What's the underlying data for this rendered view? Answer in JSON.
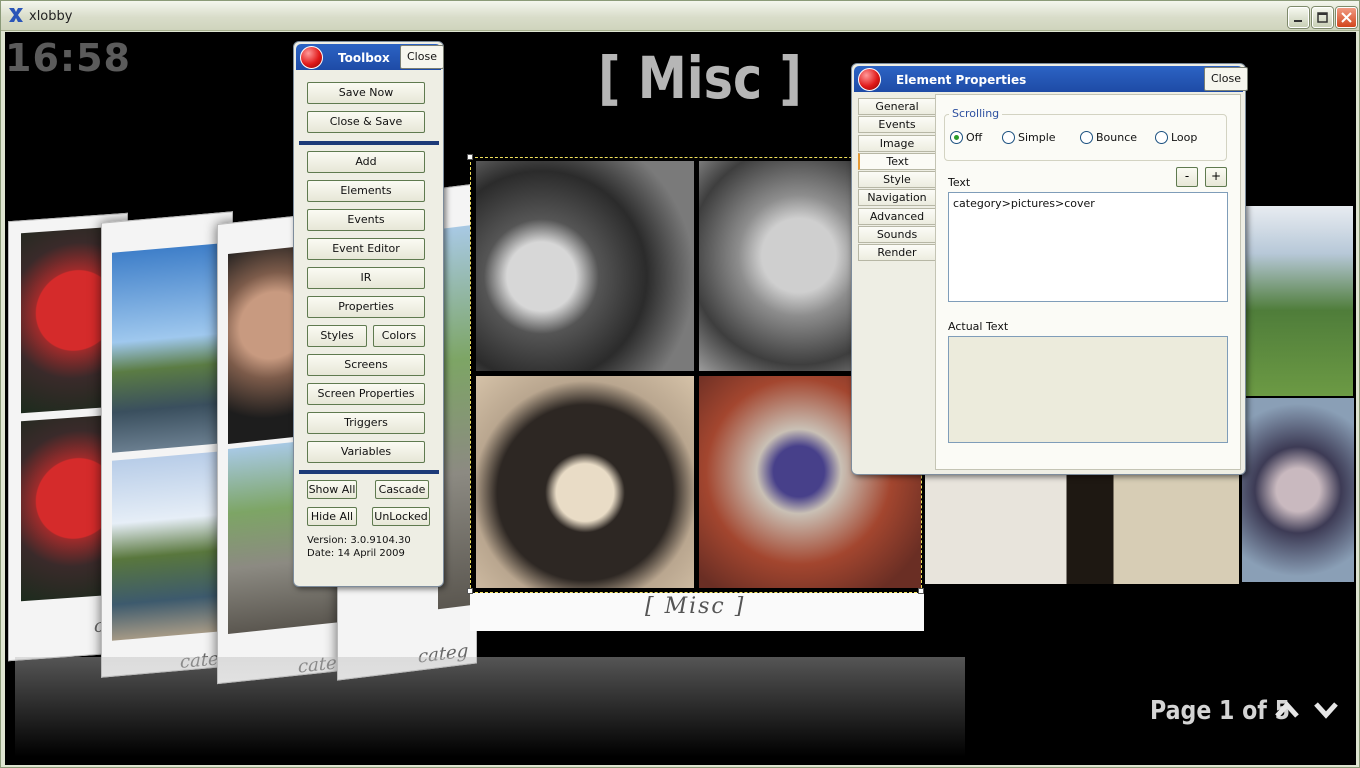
{
  "window": {
    "title": "xlobby"
  },
  "clock": "16:58",
  "screen_title": "[ Misc ]",
  "main_caption": "[ Misc ]",
  "card_captions": [
    "c",
    "categ",
    "categ",
    "categ"
  ],
  "pagination": {
    "label": "Page 1 of  5"
  },
  "toolbox": {
    "title": "Toolbox",
    "close_label": "Close",
    "save_now": "Save Now",
    "close_save": "Close & Save",
    "add": "Add",
    "elements": "Elements",
    "events": "Events",
    "event_editor": "Event Editor",
    "ir": "IR",
    "properties": "Properties",
    "styles": "Styles",
    "colors": "Colors",
    "screens": "Screens",
    "screen_properties": "Screen Properties",
    "triggers": "Triggers",
    "variables": "Variables",
    "show_all": "Show All",
    "cascade": "Cascade",
    "hide_all": "Hide All",
    "unlocked": "UnLocked",
    "version": "Version: 3.0.9104.30",
    "date": "Date: 14 April 2009"
  },
  "element_properties": {
    "title": "Element Properties",
    "close_label": "Close",
    "tabs": [
      "General",
      "Events",
      "Image",
      "Text",
      "Style",
      "Navigation",
      "Advanced",
      "Sounds",
      "Render"
    ],
    "active_tab": "Text",
    "scrolling": {
      "legend": "Scrolling",
      "options": [
        "Off",
        "Simple",
        "Bounce",
        "Loop"
      ],
      "selected": "Off"
    },
    "text_label": "Text",
    "minus": "-",
    "plus": "+",
    "text_value": "category>pictures>cover",
    "actual_text_label": "Actual Text",
    "actual_text_value": ""
  }
}
